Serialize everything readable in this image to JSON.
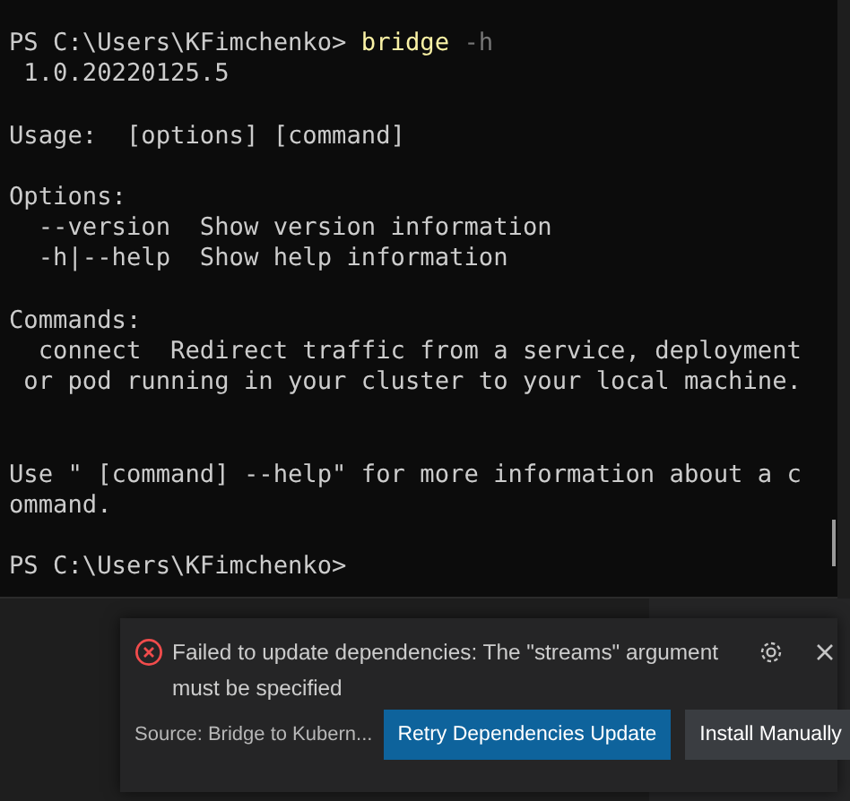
{
  "terminal": {
    "lines": [
      {
        "kind": "prompt",
        "prompt": "PS C:\\Users\\KFimchenko>",
        "command": "bridge",
        "args": "-h"
      },
      {
        "kind": "output",
        "text": " 1.0.20220125.5"
      },
      {
        "kind": "blank"
      },
      {
        "kind": "output",
        "text": "Usage:  [options] [command]"
      },
      {
        "kind": "blank"
      },
      {
        "kind": "output",
        "text": "Options:"
      },
      {
        "kind": "output",
        "text": "  --version  Show version information"
      },
      {
        "kind": "output",
        "text": "  -h|--help  Show help information"
      },
      {
        "kind": "blank"
      },
      {
        "kind": "output",
        "text": "Commands:"
      },
      {
        "kind": "output",
        "text": "  connect  Redirect traffic from a service, deployment"
      },
      {
        "kind": "output",
        "text": " or pod running in your cluster to your local machine."
      },
      {
        "kind": "blank"
      },
      {
        "kind": "blank"
      },
      {
        "kind": "output",
        "text": "Use \" [command] --help\" for more information about a c"
      },
      {
        "kind": "output",
        "text": "ommand."
      },
      {
        "kind": "blank"
      },
      {
        "kind": "prompt",
        "prompt": "PS C:\\Users\\KFimchenko>"
      }
    ]
  },
  "notification": {
    "message": "Failed to update dependencies: The \"streams\" argument must be specified",
    "source": "Source: Bridge to Kubern...",
    "buttons": [
      {
        "label": "Retry Dependencies Update",
        "kind": "primary"
      },
      {
        "label": "Install Manually",
        "kind": "secondary"
      }
    ]
  }
}
